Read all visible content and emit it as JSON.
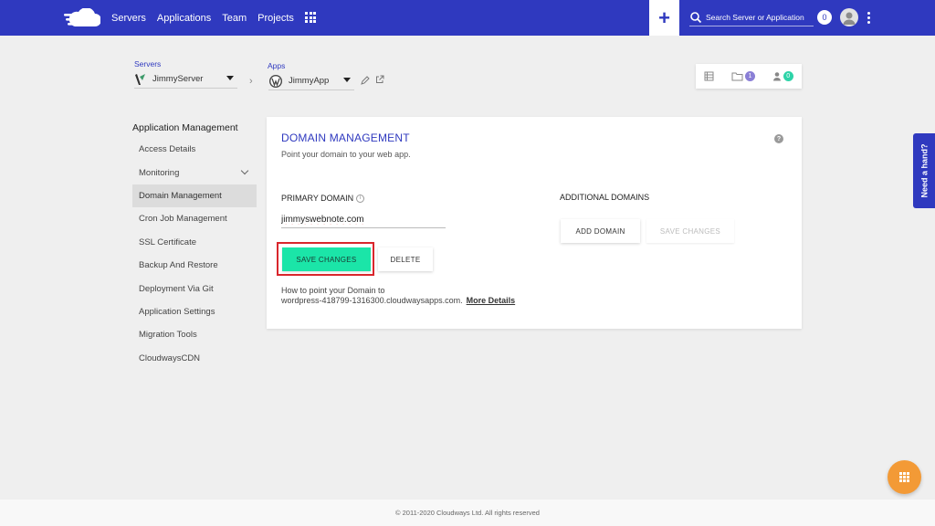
{
  "nav": {
    "logo": "cloudways-logo-icon",
    "items": [
      "Servers",
      "Applications",
      "Team",
      "Projects"
    ],
    "search_placeholder": "Search Server or Application",
    "notification_count": "0"
  },
  "breadcrumb": {
    "servers_label": "Servers",
    "server_name": "JimmyServer",
    "separator": "›",
    "apps_label": "Apps",
    "app_name": "JimmyApp"
  },
  "top_panel": {
    "files_badge": "1",
    "users_badge": "0"
  },
  "sidebar": {
    "title": "Application Management",
    "items": [
      {
        "label": "Access Details"
      },
      {
        "label": "Monitoring"
      },
      {
        "label": "Domain Management"
      },
      {
        "label": "Cron Job Management"
      },
      {
        "label": "SSL Certificate"
      },
      {
        "label": "Backup And Restore"
      },
      {
        "label": "Deployment Via Git"
      },
      {
        "label": "Application Settings"
      },
      {
        "label": "Migration Tools"
      },
      {
        "label": "CloudwaysCDN"
      }
    ]
  },
  "card": {
    "title": "DOMAIN MANAGEMENT",
    "subtitle": "Point your domain to your web app.",
    "primary_label": "PRIMARY DOMAIN",
    "primary_value": "jimmyswebnote.com",
    "save_label": "SAVE CHANGES",
    "delete_label": "DELETE",
    "additional_label": "ADDITIONAL DOMAINS",
    "add_domain_label": "ADD DOMAIN",
    "save_disabled_label": "SAVE CHANGES",
    "how_line1": "How to point your Domain to",
    "how_line2": "wordpress-418799-1316300.cloudwaysapps.com.",
    "more_details": "More Details",
    "help": "?"
  },
  "need_hand": "Need a hand?",
  "footer": "© 2011-2020 Cloudways Ltd. All rights reserved",
  "colors": {
    "primary": "#2f39bf",
    "save_button": "#1be5a8",
    "fab": "#f39a36",
    "highlight": "#d9262c"
  }
}
